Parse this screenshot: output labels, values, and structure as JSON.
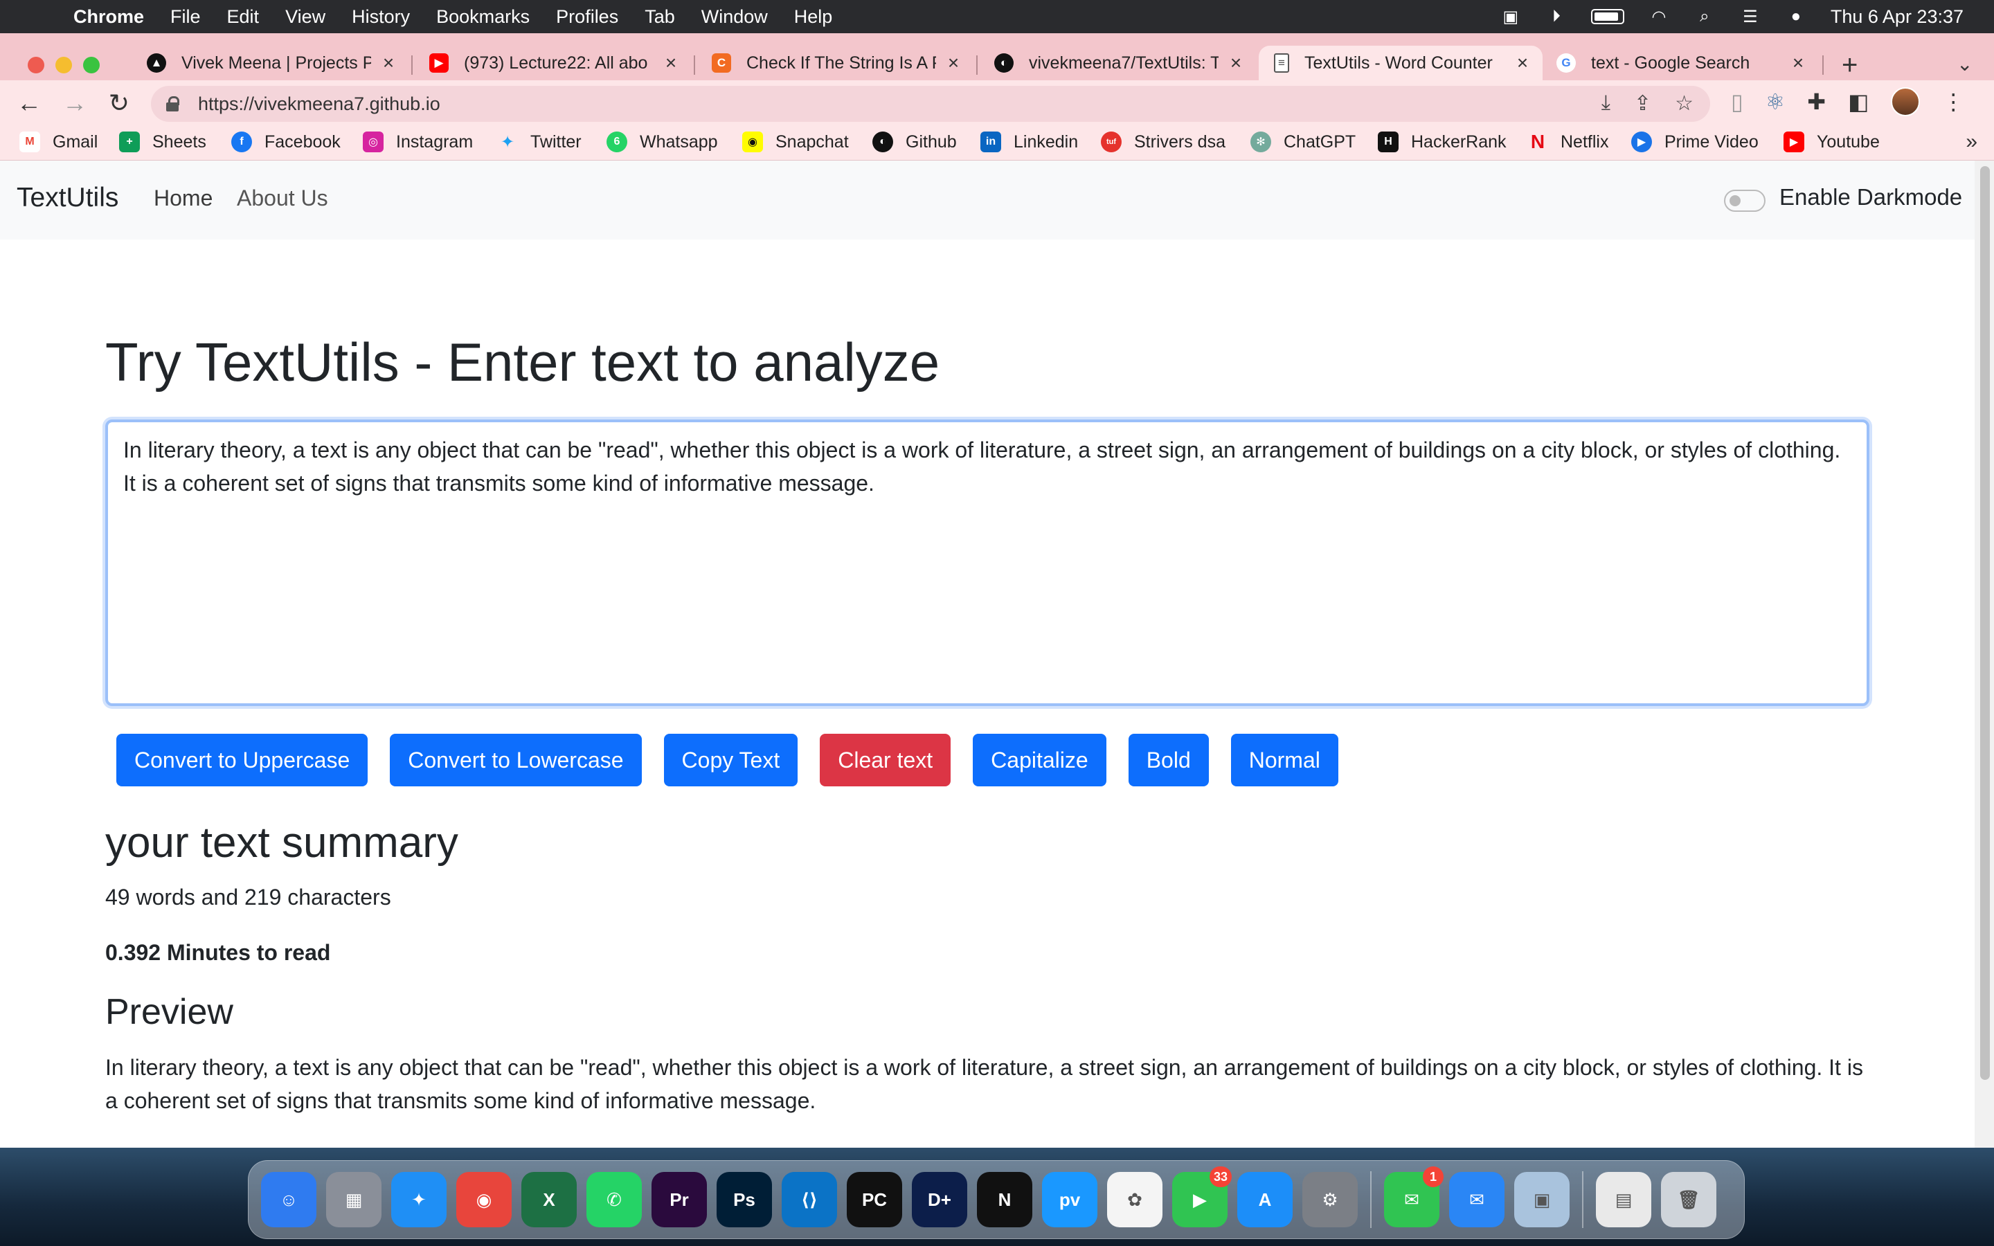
{
  "menubar": {
    "app_name": "Chrome",
    "items": [
      "File",
      "Edit",
      "View",
      "History",
      "Bookmarks",
      "Profiles",
      "Tab",
      "Window",
      "Help"
    ],
    "clock": "Thu 6 Apr  23:37"
  },
  "tabs": [
    {
      "title": "Vivek Meena | Projects P",
      "icon": "vercel-triangle-icon",
      "color": "#111111"
    },
    {
      "title": "(973) Lecture22: All abo",
      "icon": "youtube-icon",
      "color": "#ff0000"
    },
    {
      "title": "Check If The String Is A P",
      "icon": "codingninjas-icon",
      "color": "#f26b22"
    },
    {
      "title": "vivekmeena7/TextUtils: T",
      "icon": "github-icon",
      "color": "#111111"
    },
    {
      "title": "TextUtils - Word Counter",
      "icon": "document-icon",
      "color": "#ffffff",
      "active": true
    },
    {
      "title": "text - Google Search",
      "icon": "google-icon",
      "color": "#4285f4"
    }
  ],
  "address_bar": {
    "url": "https://vivekmeena7.github.io"
  },
  "bookmarks": [
    {
      "label": "Gmail",
      "color": "#ea4335",
      "glyph": "M"
    },
    {
      "label": "Sheets",
      "color": "#0f9d58",
      "glyph": "+"
    },
    {
      "label": "Facebook",
      "color": "#1877f2",
      "glyph": "f"
    },
    {
      "label": "Instagram",
      "color": "#d6249f",
      "glyph": "◎"
    },
    {
      "label": "Twitter",
      "color": "#1da1f2",
      "glyph": "t"
    },
    {
      "label": "Whatsapp",
      "color": "#25d366",
      "glyph": "6"
    },
    {
      "label": "Snapchat",
      "color": "#fffc00",
      "glyph": "◉"
    },
    {
      "label": "Github",
      "color": "#111111",
      "glyph": "◐"
    },
    {
      "label": "Linkedin",
      "color": "#0a66c2",
      "glyph": "in"
    },
    {
      "label": "Strivers dsa",
      "color": "#e5322d",
      "glyph": "tuf"
    },
    {
      "label": "ChatGPT",
      "color": "#74aa9c",
      "glyph": "✻"
    },
    {
      "label": "HackerRank",
      "color": "#111111",
      "glyph": "H"
    },
    {
      "label": "Netflix",
      "color": "#e50914",
      "glyph": "N"
    },
    {
      "label": "Prime Video",
      "color": "#1a73e8",
      "glyph": "▶"
    },
    {
      "label": "Youtube",
      "color": "#ff0000",
      "glyph": "▶"
    }
  ],
  "navbar": {
    "brand": "TextUtils",
    "links": [
      "Home",
      "About Us"
    ],
    "darkmode_label": "Enable Darkmode"
  },
  "main": {
    "heading": "Try TextUtils - Enter text to analyze",
    "textarea_value": "In literary theory, a text is any object that can be \"read\", whether this object is a work of literature, a street sign, an arrangement of buildings on a city block, or styles of clothing. It is a coherent set of signs that transmits some kind of informative message.",
    "buttons": {
      "uppercase": "Convert to Uppercase",
      "lowercase": "Convert to Lowercase",
      "copy": "Copy Text",
      "clear": "Clear text",
      "capitalize": "Capitalize",
      "bold": "Bold",
      "normal": "Normal"
    },
    "summary_heading": "your text summary",
    "counts": "49 words and 219 characters",
    "read_time": "0.392 Minutes to read",
    "preview_heading": "Preview",
    "preview_text": "In literary theory, a text is any object that can be \"read\", whether this object is a work of literature, a street sign, an arrangement of buildings on a city block, or styles of clothing. It is a coherent set of signs that transmits some kind of informative message."
  },
  "colors": {
    "primary": "#0d6efd",
    "danger": "#dc3545",
    "tabstrip": "#f3c6cc",
    "toolbar": "#fde6e8"
  },
  "dock": [
    {
      "name": "finder",
      "color": "#2f7bf0",
      "glyph": "☺"
    },
    {
      "name": "launchpad",
      "color": "#8a8f99",
      "glyph": "▦"
    },
    {
      "name": "safari",
      "color": "#1f8ff5",
      "glyph": "✦"
    },
    {
      "name": "chrome",
      "color": "#e8453c",
      "glyph": "◉"
    },
    {
      "name": "excel",
      "color": "#1d7044",
      "glyph": "X"
    },
    {
      "name": "whatsapp",
      "color": "#25d366",
      "glyph": "✆"
    },
    {
      "name": "premiere",
      "color": "#2a0a3d",
      "glyph": "Pr"
    },
    {
      "name": "photoshop",
      "color": "#001e36",
      "glyph": "Ps"
    },
    {
      "name": "vscode",
      "color": "#0b73c6",
      "glyph": "⟨⟩"
    },
    {
      "name": "pycharm",
      "color": "#111111",
      "glyph": "PC"
    },
    {
      "name": "disney-hotstar",
      "color": "#0c1e4a",
      "glyph": "D+"
    },
    {
      "name": "netflix",
      "color": "#111111",
      "glyph": "N"
    },
    {
      "name": "prime-video",
      "color": "#1a98ff",
      "glyph": "pv"
    },
    {
      "name": "photos",
      "color": "#f4f4f4",
      "glyph": "✿"
    },
    {
      "name": "facetime",
      "color": "#30c452",
      "glyph": "▶",
      "badge": "33"
    },
    {
      "name": "app-store",
      "color": "#1c8ef9",
      "glyph": "A"
    },
    {
      "name": "system-settings",
      "color": "#7b7f86",
      "glyph": "⚙"
    },
    {
      "name": "messages",
      "color": "#30c452",
      "glyph": "✉",
      "badge": "1",
      "sep_before": true
    },
    {
      "name": "mail",
      "color": "#2a86f5",
      "glyph": "✉"
    },
    {
      "name": "preview",
      "color": "#a9c3dd",
      "glyph": "▣"
    },
    {
      "name": "documents",
      "color": "#e9e9e9",
      "glyph": "▤",
      "sep_before": true
    },
    {
      "name": "trash",
      "color": "#cfd4da",
      "glyph": "🗑"
    }
  ]
}
